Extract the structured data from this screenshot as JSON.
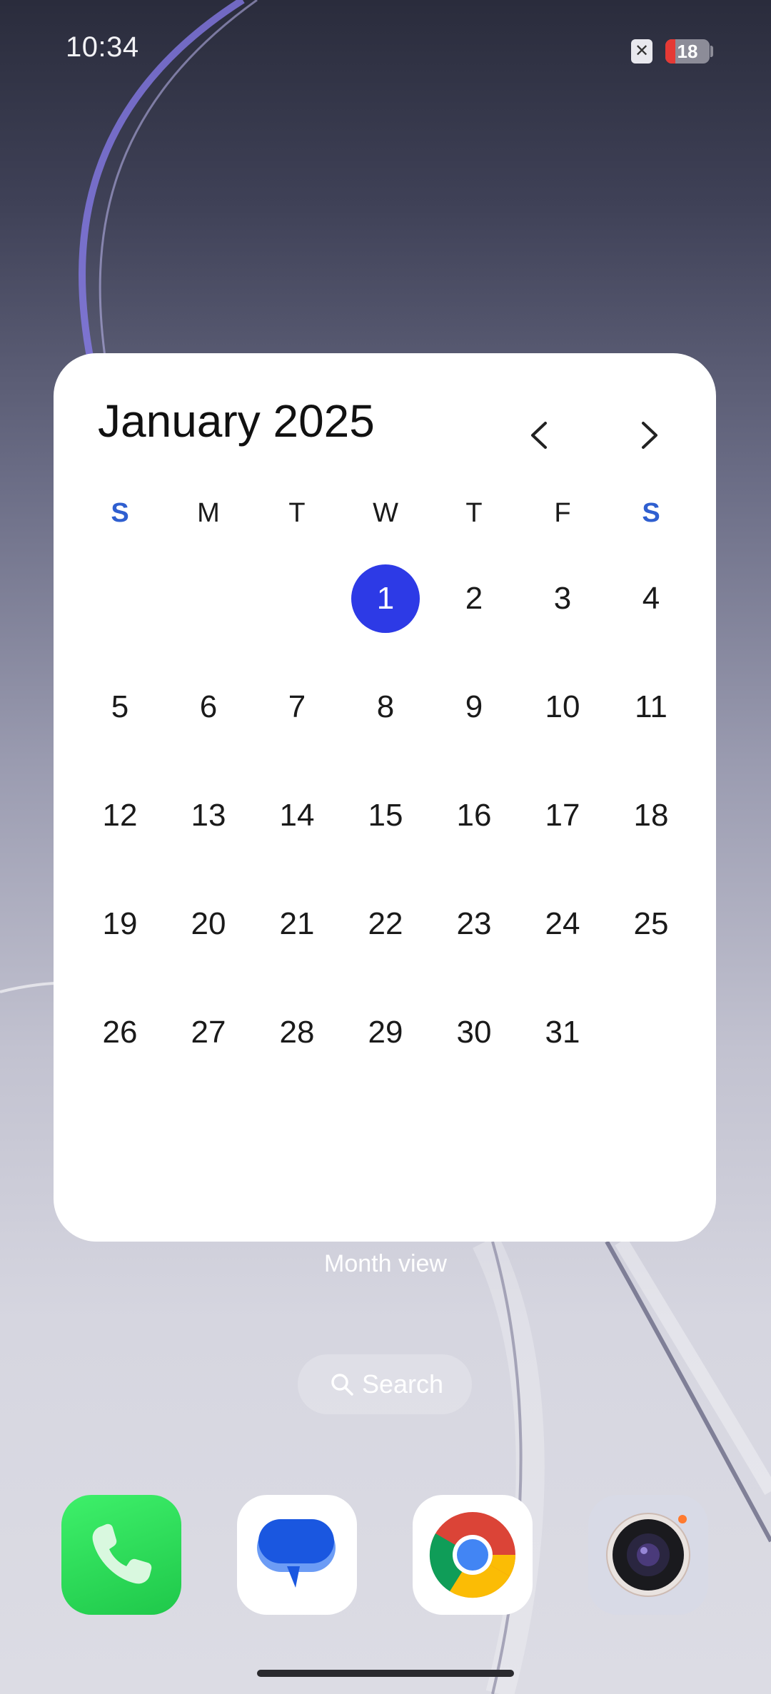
{
  "status_bar": {
    "time": "10:34",
    "sim_icon": "no-sim-icon",
    "battery_level": "18",
    "battery_color": "#e53935"
  },
  "calendar": {
    "title": "January 2025",
    "prev_icon": "chevron-left-icon",
    "next_icon": "chevron-right-icon",
    "weekdays": [
      "S",
      "M",
      "T",
      "W",
      "T",
      "F",
      "S"
    ],
    "weekend_color": "#2f5fd0",
    "today": "1",
    "today_color": "#2d3ae6",
    "weeks": [
      [
        "",
        "",
        "",
        "1",
        "2",
        "3",
        "4"
      ],
      [
        "5",
        "6",
        "7",
        "8",
        "9",
        "10",
        "11"
      ],
      [
        "12",
        "13",
        "14",
        "15",
        "16",
        "17",
        "18"
      ],
      [
        "19",
        "20",
        "21",
        "22",
        "23",
        "24",
        "25"
      ],
      [
        "26",
        "27",
        "28",
        "29",
        "30",
        "31",
        ""
      ]
    ]
  },
  "widget_caption": "Month view",
  "search": {
    "label": "Search",
    "icon": "search-icon"
  },
  "dock": {
    "apps": [
      {
        "name": "phone",
        "icon": "phone-icon"
      },
      {
        "name": "messages",
        "icon": "messages-icon"
      },
      {
        "name": "chrome",
        "icon": "chrome-icon"
      },
      {
        "name": "camera",
        "icon": "camera-icon"
      }
    ]
  }
}
